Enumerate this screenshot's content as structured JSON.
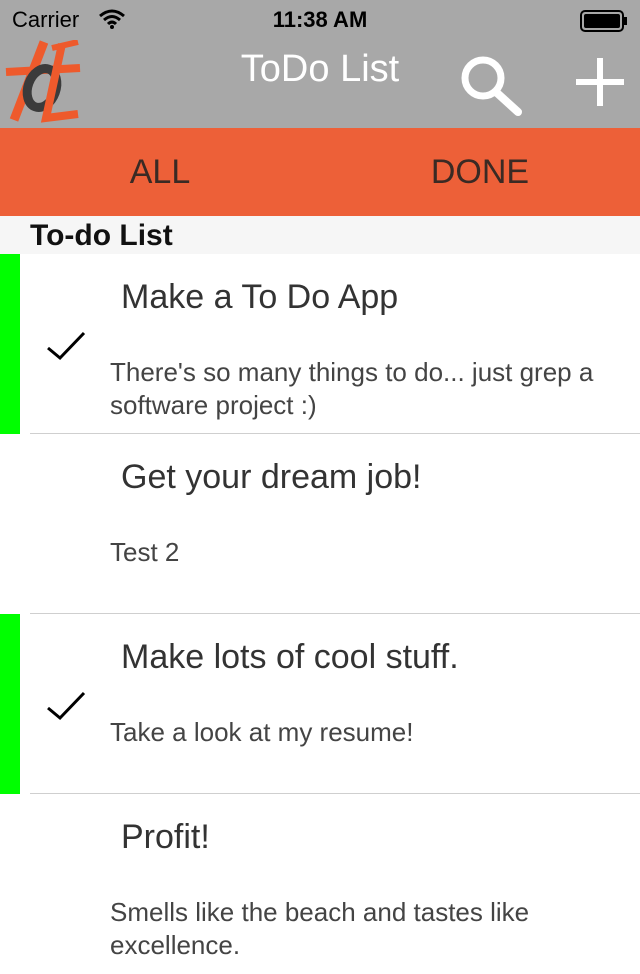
{
  "status_bar": {
    "carrier": "Carrier",
    "time": "11:38 AM"
  },
  "nav": {
    "title": "ToDo List",
    "icons": [
      "app-logo-icon",
      "search-icon",
      "add-icon"
    ]
  },
  "tabs": [
    {
      "label": "ALL"
    },
    {
      "label": "DONE"
    }
  ],
  "section": {
    "title": "To-do List"
  },
  "items": [
    {
      "title": "Make a To Do App",
      "description": "There's so many things to do... just grep a software project :)",
      "done": true
    },
    {
      "title": "Get your dream job!",
      "description": "Test 2",
      "done": false
    },
    {
      "title": "Make lots of cool stuff.",
      "description": "Take a look at my resume!",
      "done": true
    },
    {
      "title": "Profit!",
      "description": "Smells like the beach and tastes like excellence.",
      "done": false
    }
  ],
  "colors": {
    "nav_background": "#a8a8a8",
    "tab_background": "#ed6038",
    "done_indicator": "#00ff00",
    "logo_orange": "#ee5a2c",
    "logo_dark": "#3b3b3b"
  }
}
